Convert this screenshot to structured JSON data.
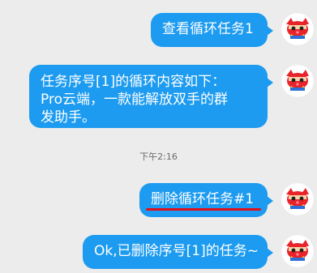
{
  "messages": [
    {
      "id": "m1",
      "text": "查看循环任务1"
    },
    {
      "id": "m2",
      "lines": [
        "任务序号[1]的循环内容如下：",
        "Pro云端，一款能解放双手的群",
        "发助手。"
      ]
    },
    {
      "id": "m3",
      "text": "删除循环任务#1"
    },
    {
      "id": "m4",
      "text": "Ok,已删除序号[1]的任务~"
    }
  ],
  "timestamp": "下午2:16",
  "avatar_icon": "red-cartoon-character-avatar-icon",
  "colors": {
    "bubble": "#1c9bf0",
    "background": "#ececec",
    "annotation": "#e0101a"
  }
}
